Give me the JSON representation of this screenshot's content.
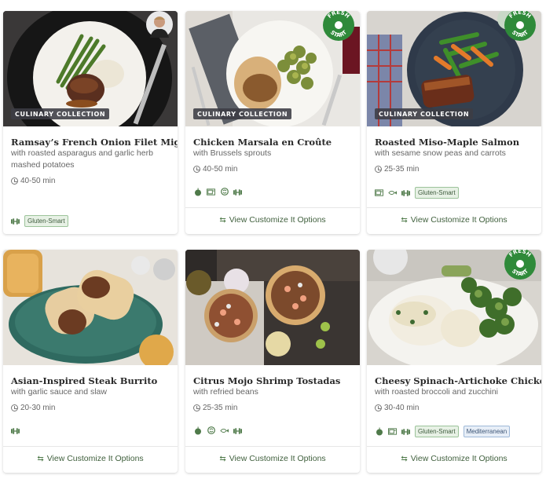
{
  "tags": {
    "culinary": "CULINARY COLLECTION"
  },
  "fresh_start": {
    "line1": "FRESH",
    "line2": "START"
  },
  "options_label": "View Customize It Options",
  "badges": {
    "gluten_smart": "Gluten-Smart",
    "mediterranean": "Mediterranean"
  },
  "cards": [
    {
      "title": "Ramsay’s French Onion Filet Mignon",
      "subtitle": "with roasted asparagus and garlic herb mashed potatoes",
      "time": "40-50 min"
    },
    {
      "title": "Chicken Marsala en Croûte",
      "subtitle": "with Brussels sprouts",
      "time": "40-50 min"
    },
    {
      "title": "Roasted Miso-Maple Salmon",
      "subtitle": "with sesame snow peas and carrots",
      "time": "25-35 min"
    },
    {
      "title": "Asian-Inspired Steak Burrito",
      "subtitle": "with garlic sauce and slaw",
      "time": "20-30 min"
    },
    {
      "title": "Citrus Mojo Shrimp Tostadas",
      "subtitle": "with refried beans",
      "time": "25-35 min"
    },
    {
      "title": "Cheesy Spinach-Artichoke Chicken",
      "subtitle": "with roasted broccoli and zucchini",
      "time": "30-40 min"
    }
  ],
  "colors": {
    "accent_green": "#3f5f3c",
    "fresh_badge": "#2f8a3a",
    "tag_bg": "#3c3c44"
  }
}
